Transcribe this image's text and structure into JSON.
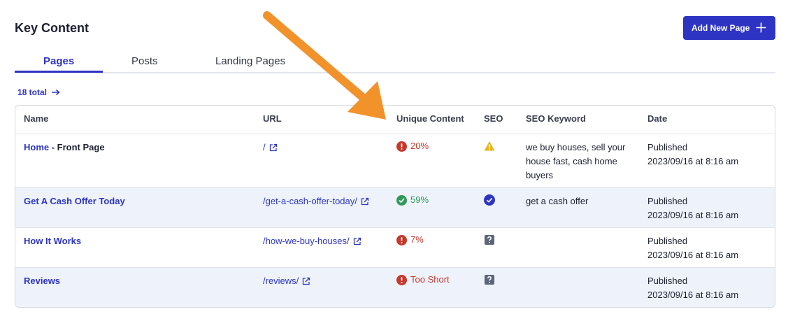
{
  "page": {
    "title": "Key Content"
  },
  "actions": {
    "add_new_label": "Add New Page"
  },
  "tabs": [
    {
      "label": "Pages",
      "active": true
    },
    {
      "label": "Posts",
      "active": false
    },
    {
      "label": "Landing Pages",
      "active": false
    }
  ],
  "total": {
    "label": "18 total"
  },
  "table": {
    "headers": {
      "name": "Name",
      "url": "URL",
      "unique": "Unique Content",
      "seo": "SEO",
      "keyword": "SEO Keyword",
      "date": "Date"
    },
    "rows": [
      {
        "name": "Home",
        "name_suffix": " - Front Page",
        "url": "/",
        "unique": "20%",
        "unique_status": "error",
        "seo_status": "warning",
        "keyword": "we buy houses, sell your house fast, cash home buyers",
        "status": "Published",
        "datetime": "2023/09/16 at 8:16 am"
      },
      {
        "name": "Get A Cash Offer Today",
        "name_suffix": "",
        "url": "/get-a-cash-offer-today/",
        "unique": "59%",
        "unique_status": "ok",
        "seo_status": "ok",
        "keyword": "get a cash offer",
        "status": "Published",
        "datetime": "2023/09/16 at 8:16 am"
      },
      {
        "name": "How It Works",
        "name_suffix": "",
        "url": "/how-we-buy-houses/",
        "unique": "7%",
        "unique_status": "error",
        "seo_status": "unknown",
        "keyword": "",
        "status": "Published",
        "datetime": "2023/09/16 at 8:16 am"
      },
      {
        "name": "Reviews",
        "name_suffix": "",
        "url": "/reviews/",
        "unique": "Too Short",
        "unique_status": "error",
        "seo_status": "unknown",
        "keyword": "",
        "status": "Published",
        "datetime": "2023/09/16 at 8:16 am"
      }
    ]
  },
  "icons": {
    "add": "plus-icon",
    "total": "arrow-right-icon",
    "external": "external-link-icon",
    "error": "exclamation-circle-icon",
    "ok": "check-circle-icon",
    "warning": "warning-triangle-icon",
    "unknown": "question-square-icon",
    "annotation": "orange-arrow-icon"
  },
  "colors": {
    "accent": "#2d34c4",
    "error": "#c8372b",
    "success": "#2f9a57",
    "warning": "#e6b51c",
    "unknown": "#5c6478",
    "annotation": "#f2922b"
  }
}
